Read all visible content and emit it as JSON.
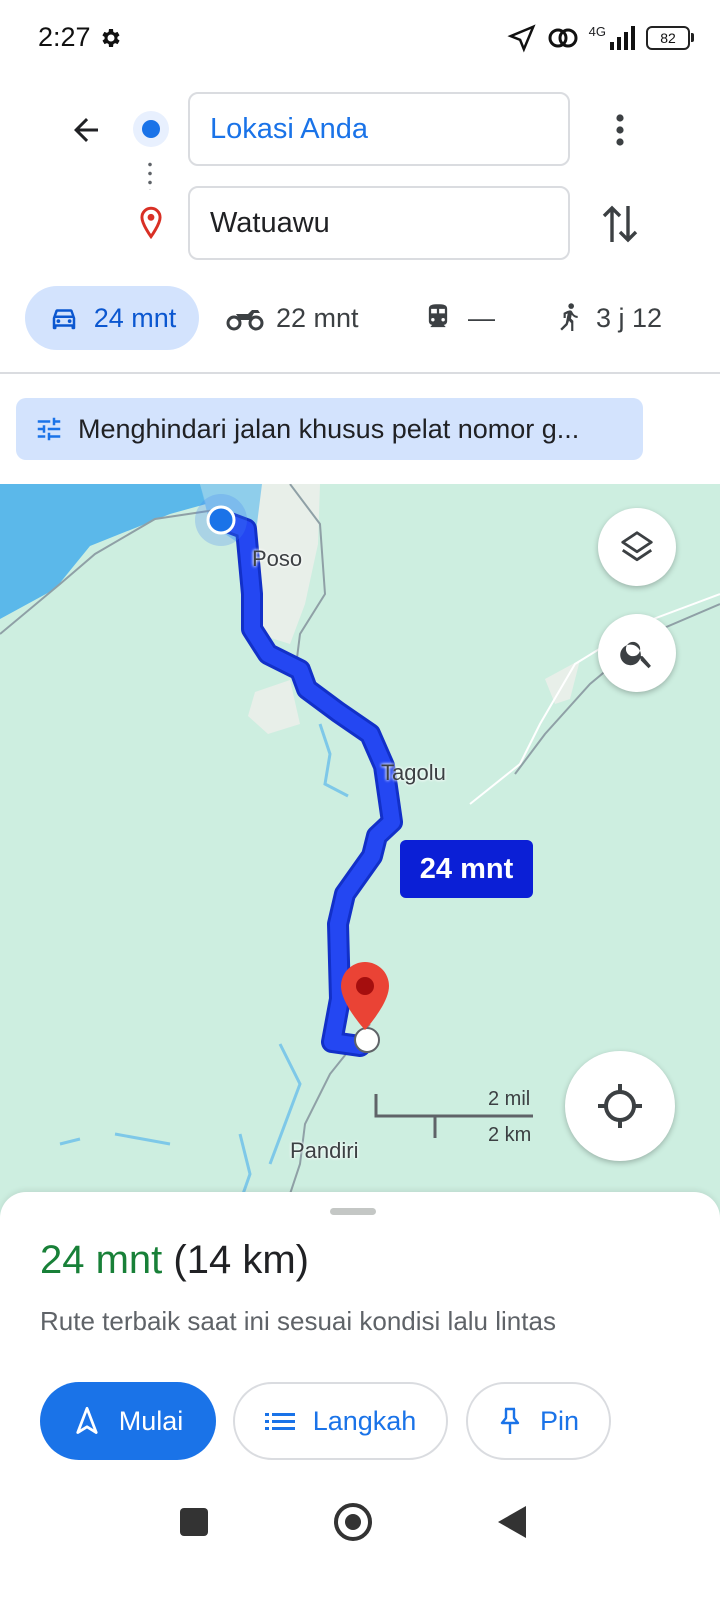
{
  "status_bar": {
    "time": "2:27",
    "network": "4G",
    "battery": "82",
    "icons": [
      "settings-gear-icon",
      "location-arrow-icon",
      "hotspot-icon",
      "signal-icon",
      "battery-icon"
    ]
  },
  "directions": {
    "origin": "Lokasi Anda",
    "destination": "Watuawu",
    "icons": [
      "back-arrow-icon",
      "more-vert-icon",
      "swap-icon",
      "destination-pin-icon"
    ]
  },
  "modes": [
    {
      "name": "car",
      "label": "24 mnt",
      "selected": true,
      "icon": "car-icon"
    },
    {
      "name": "motorcycle",
      "label": "22 mnt",
      "selected": false,
      "icon": "motorcycle-icon"
    },
    {
      "name": "transit",
      "label": "—",
      "selected": false,
      "icon": "train-icon"
    },
    {
      "name": "walk",
      "label": "3 j 12",
      "selected": false,
      "icon": "walking-icon"
    }
  ],
  "option_chip": {
    "label": "Menghindari jalan khusus pelat nomor g...",
    "icon": "tune-icon"
  },
  "map": {
    "places": {
      "poso": "Poso",
      "tagolu": "Tagolu",
      "pandiri": "Pandiri"
    },
    "route_eta": "24 mnt",
    "scale": {
      "imperial": "2 mil",
      "metric": "2 km"
    },
    "icons": [
      "layers-icon",
      "search-icon",
      "my-location-icon",
      "origin-dot-icon",
      "destination-marker-icon"
    ]
  },
  "sheet": {
    "duration": "24 mnt",
    "distance": "(14 km)",
    "description": "Rute terbaik saat ini sesuai kondisi lalu lintas",
    "start_label": "Mulai",
    "steps_label": "Langkah",
    "pin_label": "Pin"
  },
  "colors": {
    "accent": "#1a73e8",
    "route": "#2447f2",
    "duration_green": "#188038",
    "map_bg": "#cdeee0",
    "water": "#5bb8ea",
    "chip_bg": "#d3e3fd",
    "pin_red": "#ea4335"
  }
}
